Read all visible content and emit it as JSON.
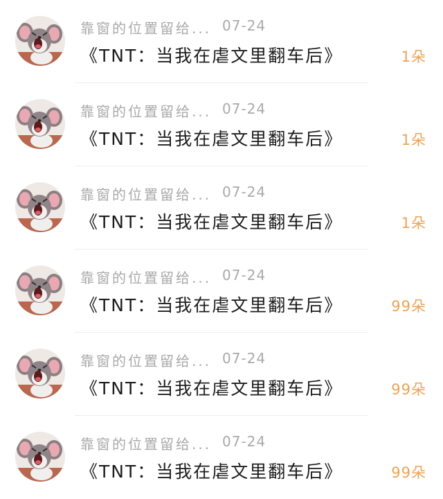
{
  "items": [
    {
      "user": "靠窗的位置留给...",
      "date": "07-24",
      "title": "《TNT：当我在虐文里翻车后》",
      "count": "1朵",
      "avatar_icon": "crying-mouse-avatar-icon"
    },
    {
      "user": "靠窗的位置留给...",
      "date": "07-24",
      "title": "《TNT：当我在虐文里翻车后》",
      "count": "1朵",
      "avatar_icon": "crying-mouse-avatar-icon"
    },
    {
      "user": "靠窗的位置留给...",
      "date": "07-24",
      "title": "《TNT：当我在虐文里翻车后》",
      "count": "1朵",
      "avatar_icon": "crying-mouse-avatar-icon"
    },
    {
      "user": "靠窗的位置留给...",
      "date": "07-24",
      "title": "《TNT：当我在虐文里翻车后》",
      "count": "99朵",
      "avatar_icon": "crying-mouse-avatar-icon"
    },
    {
      "user": "靠窗的位置留给...",
      "date": "07-24",
      "title": "《TNT：当我在虐文里翻车后》",
      "count": "99朵",
      "avatar_icon": "crying-mouse-avatar-icon"
    },
    {
      "user": "靠窗的位置留给...",
      "date": "07-24",
      "title": "《TNT：当我在虐文里翻车后》",
      "count": "99朵",
      "avatar_icon": "crying-mouse-avatar-icon"
    }
  ],
  "colors": {
    "meta_text": "#a9a9a9",
    "title_text": "#1c1c1c",
    "count_accent": "#eda255",
    "divider": "#ececec"
  }
}
